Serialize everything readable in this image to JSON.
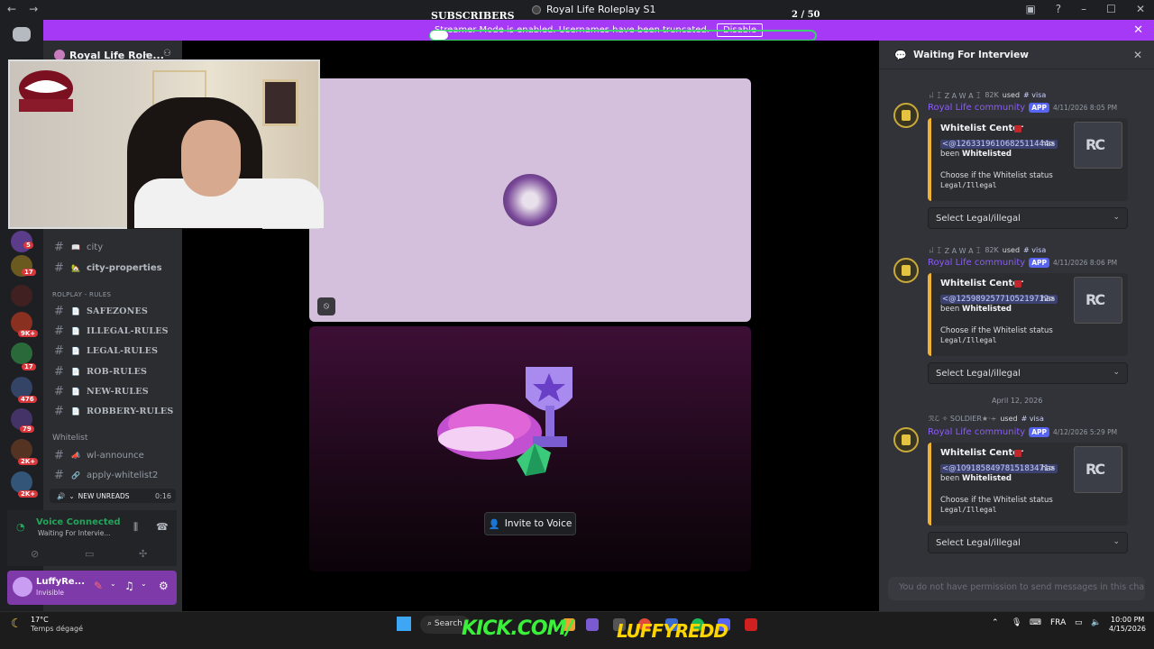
{
  "titlebar": {
    "title": "Royal Life Roleplay S1",
    "subscribers_label": "SUBSCRIBERS",
    "subscribers_count": "2 / 50",
    "back": "←",
    "forward": "→"
  },
  "banner": {
    "text": "Streamer Mode is enabled. Usernames have been truncated.",
    "button": "Disable",
    "color": "#a539f5"
  },
  "server": {
    "name": "Royal Life Role...",
    "badges": [
      "5",
      "17",
      "9K+",
      "17",
      "476",
      "79",
      "2K+",
      "2K+"
    ]
  },
  "channels": {
    "top": [
      {
        "name": "city",
        "emoji": "📖"
      },
      {
        "name": "city-properties",
        "emoji": "🏡"
      }
    ],
    "rules_category": "ROLPLAY - RULES",
    "rules": [
      {
        "name": "SAFEZONES",
        "emoji": "📄"
      },
      {
        "name": "ILLEGAL-RULES",
        "emoji": "📄"
      },
      {
        "name": "LEGAL-RULES",
        "emoji": "📄"
      },
      {
        "name": "ROB-RULES",
        "emoji": "📄"
      },
      {
        "name": "NEW-RULES",
        "emoji": "📄"
      },
      {
        "name": "ROBBERY-RULES",
        "emoji": "📄"
      }
    ],
    "whitelist_category": "Whitelist",
    "whitelist": [
      {
        "name": "wl-announce",
        "emoji": "📣"
      },
      {
        "name": "apply-whitelist2",
        "emoji": "🔗"
      }
    ],
    "new_unreads": "NEW UNREADS",
    "voice_timer": "0:16"
  },
  "voice": {
    "title": "Voice Connected",
    "channel": "Waiting For Intervie..."
  },
  "user": {
    "name": "LuffyRe...",
    "status": "Invisible"
  },
  "stage": {
    "invite_label": "Invite to Voice"
  },
  "thread": {
    "title": "Waiting For Interview",
    "messages": [
      {
        "reply_user": "ꈤ ꀤ Z A W A ꀤ",
        "reply_tag": "82K",
        "reply_channel": "# visa",
        "author": "Royal Life community",
        "app_tag": "APP",
        "time": "4/11/2026 8:05 PM",
        "embed_title": "Whitelist Center",
        "mention": "<@1263319610682511444>",
        "has": "has",
        "been_prefix": "been",
        "been_bold": "Whitelisted",
        "choose": "Choose if the Whitelist status",
        "code": "Legal/Illegal",
        "select": "Select Legal/illegal"
      },
      {
        "reply_user": "ꈤ ꀤ Z A W A ꀤ",
        "reply_tag": "82K",
        "reply_channel": "# visa",
        "author": "Royal Life community",
        "app_tag": "APP",
        "time": "4/11/2026 8:06 PM",
        "embed_title": "Whitelist Center",
        "mention": "<@1259892577105219712>",
        "has": "has",
        "been_prefix": "been",
        "been_bold": "Whitelisted",
        "choose": "Choose if the Whitelist status",
        "code": "Legal/Illegal",
        "select": "Select Legal/illegal"
      },
      {
        "reply_user": "ℛℒ ✧ SOLDIER★·∻",
        "reply_tag": "",
        "reply_channel": "# visa",
        "author": "Royal Life community",
        "app_tag": "APP",
        "time": "4/12/2026 5:29 PM",
        "embed_title": "Whitelist Center",
        "mention": "<@1091858497815183471>",
        "has": "has",
        "been_prefix": "been",
        "been_bold": "Whitelisted",
        "choose": "Choose if the Whitelist status",
        "code": "Legal/Illegal",
        "select": "Select Legal/illegal"
      }
    ],
    "date_divider": "April 12, 2026",
    "no_permission": "You do not have permission to send messages in this cha..."
  },
  "taskbar": {
    "temp": "17°C",
    "weather": "Temps dégagé",
    "search": "Search",
    "overlay_left": "KICK.COM/",
    "overlay_right": "LUFFYREDD",
    "lang": "FRA",
    "time": "10:00 PM",
    "date": "4/15/2026"
  },
  "colors": {
    "accent": "#5865f2",
    "voice_green": "#23a55a",
    "embed_bar": "#f0b232",
    "user_panel": "#7e3aa8"
  }
}
